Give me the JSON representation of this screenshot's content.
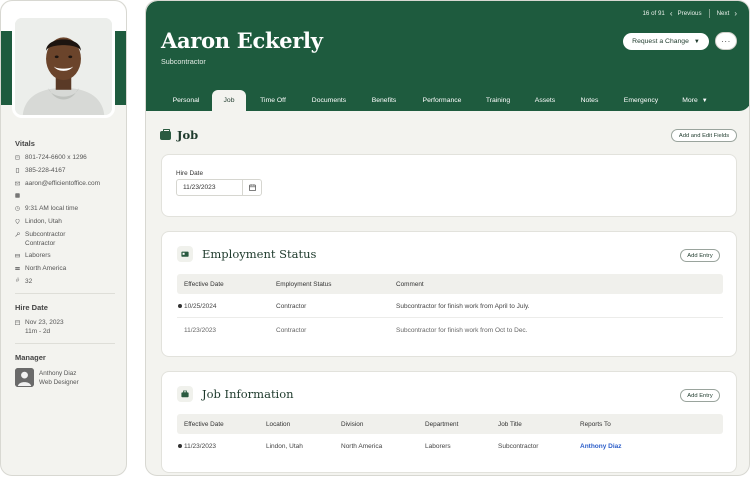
{
  "sidebar": {
    "vitals_title": "Vitals",
    "phone_work": "801-724-6600 x 1296",
    "phone_mobile": "385-228-4167",
    "email": "aaron@efficientoffice.com",
    "linkedin": "in",
    "local_time": "9:31 AM local time",
    "location": "Lindon, Utah",
    "job_title": "Subcontractor",
    "employment_type": "Contractor",
    "department": "Laborers",
    "division": "North America",
    "employee_number": "32",
    "hire_date_title": "Hire Date",
    "hire_date": "Nov 23, 2023",
    "tenure": "11m - 2d",
    "manager_title": "Manager",
    "manager_name": "Anthony Diaz",
    "manager_role": "Web Designer"
  },
  "header": {
    "pager_position": "16 of 91",
    "pager_previous": "Previous",
    "pager_next": "Next",
    "name": "Aaron Eckerly",
    "role": "Subcontractor",
    "request_change_label": "Request a Change",
    "more_label": "···"
  },
  "tabs": [
    {
      "label": "Personal"
    },
    {
      "label": "Job"
    },
    {
      "label": "Time Off"
    },
    {
      "label": "Documents"
    },
    {
      "label": "Benefits"
    },
    {
      "label": "Performance"
    },
    {
      "label": "Training"
    },
    {
      "label": "Assets"
    },
    {
      "label": "Notes"
    },
    {
      "label": "Emergency"
    },
    {
      "label": "More"
    }
  ],
  "page": {
    "title": "Job",
    "add_edit_fields_label": "Add and Edit Fields",
    "hire_date_label": "Hire Date",
    "hire_date_value": "11/23/2023"
  },
  "employment_status": {
    "title": "Employment Status",
    "add_entry_label": "Add Entry",
    "columns": [
      "Effective Date",
      "Employment Status",
      "Comment"
    ],
    "rows": [
      [
        "10/25/2024",
        "Contractor",
        "Subcontractor for finish work from April to July."
      ],
      [
        "11/23/2023",
        "Contractor",
        "Subcontractor for finish work from Oct to Dec."
      ]
    ]
  },
  "job_information": {
    "title": "Job Information",
    "add_entry_label": "Add Entry",
    "columns": [
      "Effective Date",
      "Location",
      "Division",
      "Department",
      "Job Title",
      "Reports To"
    ],
    "rows": [
      [
        "11/23/2023",
        "Lindon, Utah",
        "North America",
        "Laborers",
        "Subcontractor",
        "Anthony Diaz"
      ]
    ]
  },
  "colors": {
    "brand_green": "#1e5b3e",
    "link_blue": "#2c5ec9",
    "panel_bg": "#f3f3ef"
  }
}
